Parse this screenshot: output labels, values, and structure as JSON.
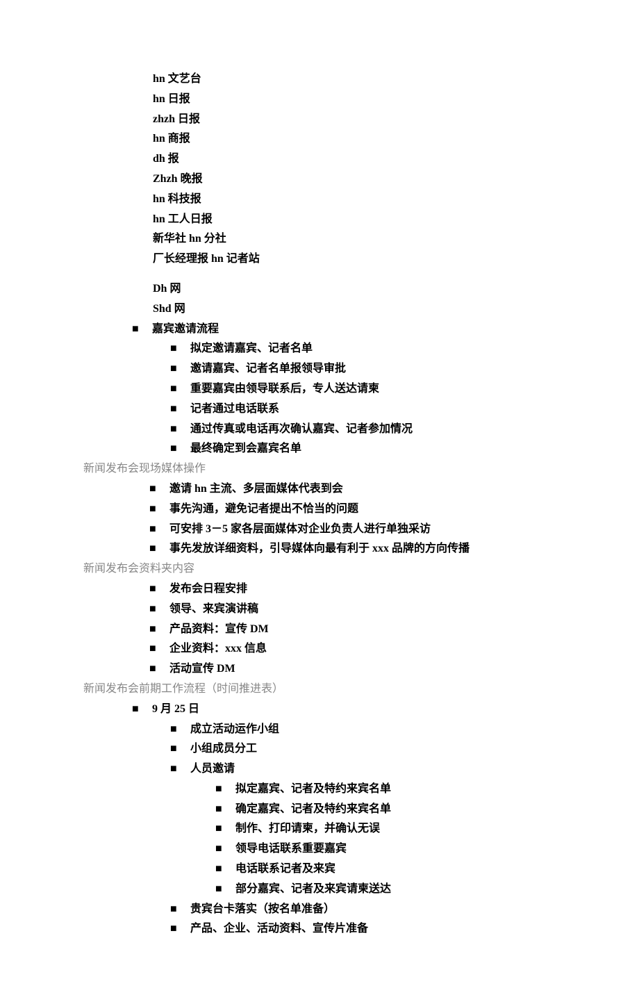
{
  "mediaList": [
    "hn 文艺台",
    "hn 日报",
    "zhzh 日报",
    "hn 商报",
    "dh 报",
    "Zhzh 晚报",
    "hn 科技报",
    "hn 工人日报",
    "新华社 hn 分社",
    "厂长经理报 hn 记者站"
  ],
  "webList": [
    "Dh 网",
    "Shd 网"
  ],
  "inviteFlow": {
    "title": "嘉宾邀请流程",
    "items": [
      "拟定邀请嘉宾、记者名单",
      "邀请嘉宾、记者名单报领导审批",
      "重要嘉宾由领导联系后，专人送达请柬",
      "记者通过电话联系",
      "通过传真或电话再次确认嘉宾、记者参加情况",
      "最终确定到会嘉宾名单"
    ]
  },
  "sceneOperation": {
    "title": "新闻发布会现场媒体操作",
    "items": [
      "邀请 hn 主流、多层面媒体代表到会",
      "事先沟通，避免记者提出不恰当的问题",
      "可安排 3－5 家各层面媒体对企业负责人进行单独采访",
      "事先发放详细资料，引导媒体向最有利于 xxx 品牌的方向传播"
    ]
  },
  "folderContent": {
    "title": "新闻发布会资料夹内容",
    "items": [
      "发布会日程安排",
      "领导、来宾演讲稿",
      "产品资料：宣传 DM",
      "企业资料：xxx 信息",
      "活动宣传 DM"
    ]
  },
  "preWork": {
    "title": "新闻发布会前期工作流程（时间推进表）",
    "date": "9 月 25 日",
    "items1": [
      "成立活动运作小组",
      "小组成员分工",
      "人员邀请"
    ],
    "subItems": [
      "拟定嘉宾、记者及特约来宾名单",
      "确定嘉宾、记者及特约来宾名单",
      "制作、打印请柬，并确认无误",
      "领导电话联系重要嘉宾",
      "电话联系记者及来宾",
      "部分嘉宾、记者及来宾请柬送达"
    ],
    "items2": [
      "贵宾台卡落实（按名单准备）",
      "产品、企业、活动资料、宣传片准备"
    ]
  },
  "bullet": "■"
}
